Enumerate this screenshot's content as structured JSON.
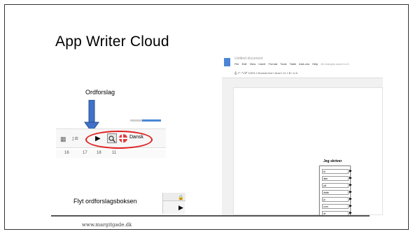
{
  "slide": {
    "title": "App Writer Cloud",
    "ordforslag_label": "Ordforslag",
    "flyt_label": "Flyt ordforslagsboksen",
    "footer": "www.margitgade.dk"
  },
  "toolbar": {
    "grid_icon": "▦",
    "lines_icon": "↕≡",
    "play_icon": "▶",
    "language": "Dansk",
    "ruler": [
      "16",
      "17",
      "18",
      "11"
    ]
  },
  "flyt_box": {
    "lock_icon": "🔒",
    "play_icon": "▶"
  },
  "doc": {
    "title": "Untitled document",
    "menu": [
      "File",
      "Edit",
      "View",
      "Insert",
      "Format",
      "Tools",
      "Table",
      "Add-ons",
      "Help"
    ],
    "saved": "All changes saved in D",
    "tools": "⎙ ↶ ↷ ⤱   100% ▾   Normal text ▾   Arial ▾   11 ▾  B  I  U  A",
    "panel_title": "Jeg skriver",
    "words": [
      "til",
      "ikke",
      "på",
      "dette",
      "jo",
      "som",
      "at",
      "for",
      "fordi",
      "hvad"
    ],
    "arrow_icon": "▶"
  },
  "colors": {
    "ellipse": "#e02020",
    "accent_blue": "#4b86d6"
  }
}
